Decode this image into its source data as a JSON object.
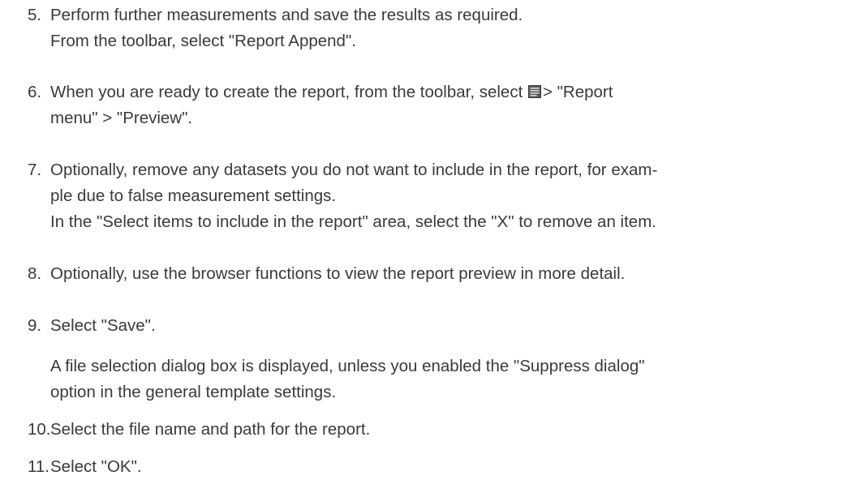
{
  "steps": [
    {
      "number": "5.",
      "lines": [
        "Perform further measurements and save the results as required.",
        "From the toolbar, select \"Report Append\"."
      ]
    },
    {
      "number": "6.",
      "line1_before_icon": "When you are ready to create the report, from the toolbar, select",
      "line1_after_icon": "> \"Report",
      "icon": "report-menu-icon",
      "line2": "menu\" > \"Preview\"."
    },
    {
      "number": "7.",
      "lines": [
        "Optionally, remove any datasets you do not want to include in the report, for exam-",
        "ple due to false measurement settings.",
        "In the \"Select items to include in the report\" area, select the \"X\" to remove an item."
      ]
    },
    {
      "number": "8.",
      "lines": [
        "Optionally, use the browser functions to view the report preview in more detail."
      ]
    },
    {
      "number": "9.",
      "lines": [
        "Select \"Save\"."
      ]
    },
    {
      "result_lines": [
        "A file selection dialog box is displayed, unless you enabled the \"Suppress dialog\"",
        "option in the general template settings."
      ]
    },
    {
      "number": "10.",
      "lines": [
        "Select the file name and path for the report."
      ]
    },
    {
      "number": "11.",
      "lines": [
        "Select \"OK\"."
      ]
    }
  ]
}
